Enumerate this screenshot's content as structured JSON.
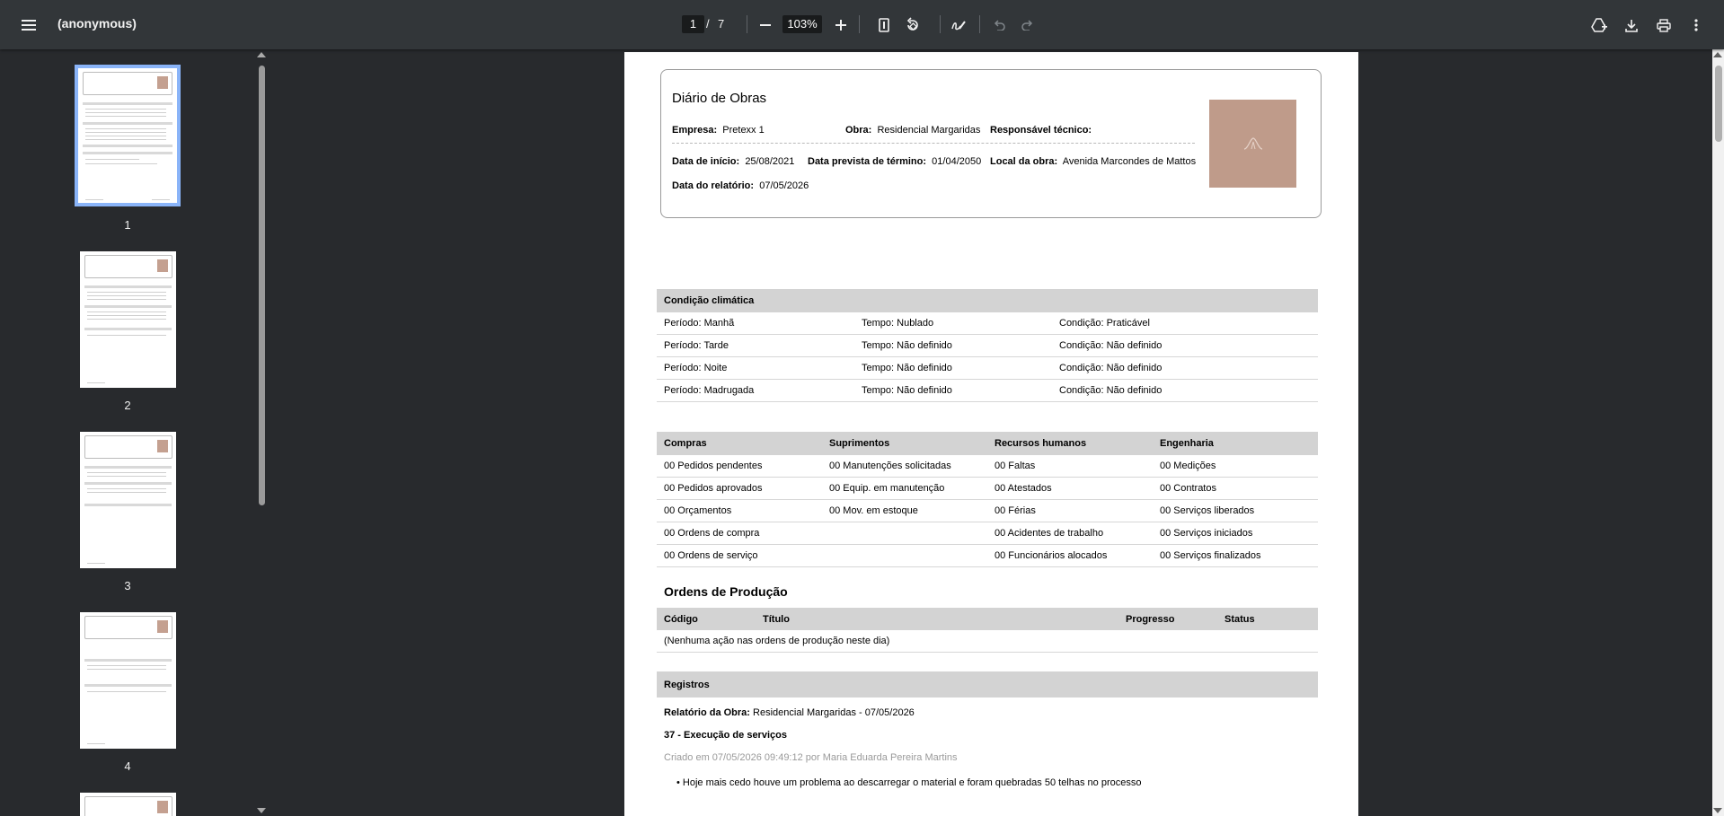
{
  "toolbar": {
    "title": "(anonymous)",
    "page_current": "1",
    "page_separator": "/",
    "page_total": "7",
    "zoom": "103%"
  },
  "thumbnails": [
    {
      "label": "1",
      "selected": true
    },
    {
      "label": "2",
      "selected": false
    },
    {
      "label": "3",
      "selected": false
    },
    {
      "label": "4",
      "selected": false
    }
  ],
  "document": {
    "title": "Diário de Obras",
    "company_label": "Empresa:",
    "company_value": "Pretexx 1",
    "project_label": "Obra:",
    "project_value": "Residencial Margaridas",
    "tech_label": "Responsável técnico:",
    "tech_value": "",
    "start_label": "Data de início:",
    "start_value": "25/08/2021",
    "end_label": "Data prevista de término:",
    "end_value": "01/04/2050",
    "site_label": "Local da obra:",
    "site_value": "Avenida Marcondes de Mattos",
    "report_label": "Data do relatório:",
    "report_value": "07/05/2026",
    "climate": {
      "heading": "Condição climática",
      "rows": [
        [
          "Período: Manhã",
          "Tempo: Nublado",
          "Condição: Praticável"
        ],
        [
          "Período: Tarde",
          "Tempo: Não definido",
          "Condição: Não definido"
        ],
        [
          "Período: Noite",
          "Tempo: Não definido",
          "Condição: Não definido"
        ],
        [
          "Período: Madrugada",
          "Tempo: Não definido",
          "Condição: Não definido"
        ]
      ]
    },
    "summary": {
      "headers": [
        "Compras",
        "Suprimentos",
        "Recursos humanos",
        "Engenharia"
      ],
      "rows": [
        [
          "00 Pedidos pendentes",
          "00 Manutenções solicitadas",
          "00 Faltas",
          "00 Medições"
        ],
        [
          "00 Pedidos aprovados",
          "00 Equip. em manutenção",
          "00 Atestados",
          "00 Contratos"
        ],
        [
          "00 Orçamentos",
          "00 Mov. em estoque",
          "00 Férias",
          "00 Serviços liberados"
        ],
        [
          "00 Ordens de compra",
          "",
          "00 Acidentes de trabalho",
          "00 Serviços iniciados"
        ],
        [
          "00 Ordens de serviço",
          "",
          "00 Funcionários alocados",
          "00 Serviços finalizados"
        ]
      ]
    },
    "production": {
      "title": "Ordens de Produção",
      "headers": [
        "Código",
        "Título",
        "Progresso",
        "Status"
      ],
      "empty": "(Nenhuma ação nas ordens de produção neste dia)"
    },
    "records": {
      "heading": "Registros",
      "report_label": "Relatório da Obra:",
      "report_value": "Residencial Margaridas - 07/05/2026",
      "entry_title": "37 - Execução de serviços",
      "created": "Criado em 07/05/2026 09:49:12 por Maria Eduarda Pereira Martins",
      "bullet": "• Hoje mais cedo houve um problema ao descarregar o material e foram quebradas 50 telhas no processo"
    }
  }
}
